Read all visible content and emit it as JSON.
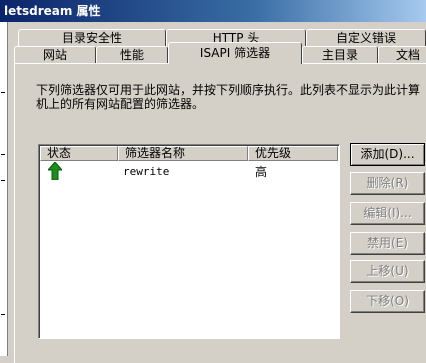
{
  "window": {
    "title": "letsdream 属性"
  },
  "tabs_back_row": [
    {
      "label": "目录安全性"
    },
    {
      "label": "HTTP 头"
    },
    {
      "label": "自定义错误"
    }
  ],
  "tabs_front_row": [
    {
      "label": "网站"
    },
    {
      "label": "性能"
    },
    {
      "label": "ISAPI 筛选器",
      "active": true
    },
    {
      "label": "主目录"
    },
    {
      "label": "文档"
    }
  ],
  "description": "下列筛选器仅可用于此网站，并按下列顺序执行。此列表不显示为此计算机上的所有网站配置的筛选器。",
  "filter_list": {
    "columns": [
      "状态",
      "筛选器名称",
      "优先级"
    ],
    "rows": [
      {
        "status_icon": "green-up-arrow-icon",
        "name": "rewrite",
        "priority": "高"
      }
    ]
  },
  "buttons": {
    "add": "添加(D)...",
    "remove": "删除(R)",
    "edit": "编辑(I)...",
    "disable": "禁用(E)",
    "move_up": "上移(U)",
    "move_down": "下移(O)"
  },
  "colors": {
    "title_bar": "#0a246a",
    "status_arrow": "#1e8c1e"
  }
}
